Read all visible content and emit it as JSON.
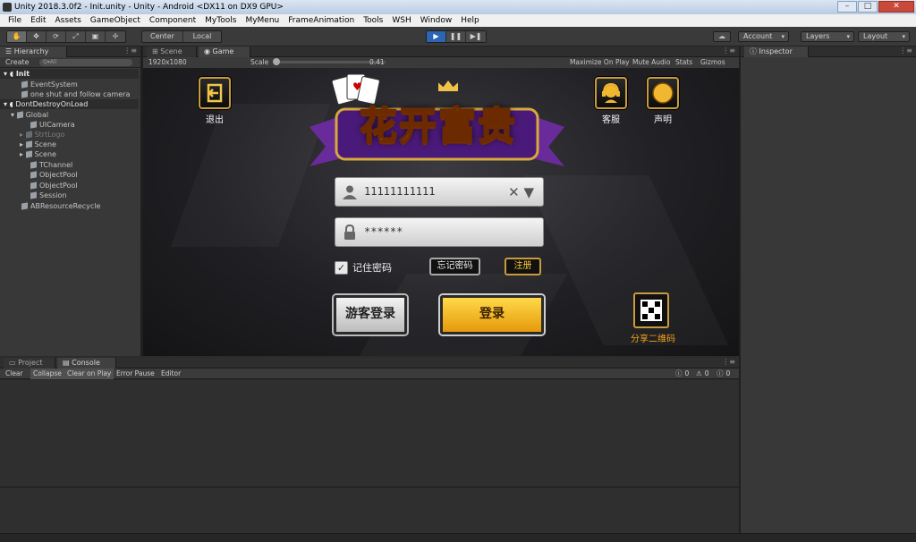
{
  "window": {
    "title": "Unity 2018.3.0f2 - Init.unity - Unity - Android <DX11 on DX9 GPU>",
    "controls": [
      "–",
      "□",
      "✕"
    ]
  },
  "menu": [
    "File",
    "Edit",
    "Assets",
    "GameObject",
    "Component",
    "MyTools",
    "MyMenu",
    "FrameAnimation",
    "Tools",
    "WSH",
    "Window",
    "Help"
  ],
  "toolbar": {
    "tools": [
      "✋",
      "✥",
      "⟳",
      "⤢",
      "▣",
      "✢"
    ],
    "pivot": [
      "Center",
      "Local"
    ],
    "play": [
      "▶",
      "❚❚",
      "▶❚"
    ],
    "cloud": "☁",
    "account": "Account",
    "layers": "Layers",
    "layout": "Layout"
  },
  "hierarchy": {
    "tab": "Hierarchy",
    "create": "Create",
    "search_placeholder": "Q▾All",
    "rows": [
      {
        "label": "Init",
        "kind": "scene"
      },
      {
        "label": "EventSystem",
        "kind": "obj"
      },
      {
        "label": "one shut and follow camera",
        "kind": "obj"
      },
      {
        "label": "DontDestroyOnLoad",
        "kind": "scene"
      },
      {
        "label": "Global",
        "kind": "obj"
      },
      {
        "label": "UICamera",
        "kind": "obj"
      },
      {
        "label": "StrtLogo",
        "kind": "dim"
      },
      {
        "label": "Scene",
        "kind": "obj"
      },
      {
        "label": "Scene",
        "kind": "obj"
      },
      {
        "label": "TChannel",
        "kind": "obj"
      },
      {
        "label": "ObjectPool",
        "kind": "obj"
      },
      {
        "label": "ObjectPool",
        "kind": "obj"
      },
      {
        "label": "Session",
        "kind": "obj"
      },
      {
        "label": "ABResourceRecycle",
        "kind": "obj"
      }
    ]
  },
  "game_view": {
    "tabs": [
      "Scene",
      "Game"
    ],
    "resolution": "1920x1080",
    "scale_label": "Scale",
    "scale_value": "0.41",
    "options": [
      "Maximize On Play",
      "Mute Audio",
      "Stats",
      "Gizmos"
    ],
    "exit_label": "退出",
    "service_label": "客服",
    "statement_label": "声明",
    "logo_text": "花开富贵",
    "account_value": "11111111111",
    "password_value": "******",
    "remember_label": "记住密码",
    "forgot_label": "忘记密码",
    "register_label": "注册",
    "guest_login_label": "游客登录",
    "login_label": "登录",
    "share_qr_label": "分享二维码"
  },
  "console": {
    "tabs": [
      "Project",
      "Console"
    ],
    "buttons": [
      "Clear",
      "Collapse",
      "Clear on Play",
      "Error Pause",
      "Editor"
    ],
    "counts": [
      "0",
      "0",
      "0"
    ]
  },
  "inspector": {
    "tab": "Inspector"
  }
}
